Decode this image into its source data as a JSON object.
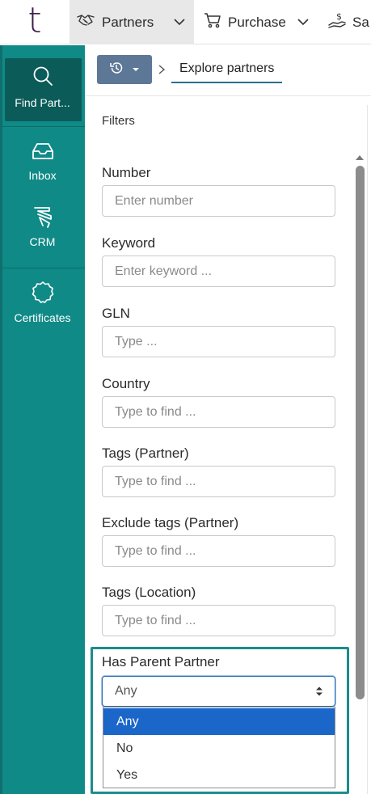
{
  "topbar": {
    "logo_text": "t",
    "nav": {
      "partners_label": "Partners",
      "purchase_label": "Purchase",
      "sales_label": "Sa"
    }
  },
  "rail": {
    "items": [
      {
        "label": "Find Part...",
        "icon": "search-icon",
        "active": true
      },
      {
        "label": "Inbox",
        "icon": "inbox-icon"
      },
      {
        "label": "CRM",
        "icon": "crm-icon"
      },
      {
        "label": "Certificates",
        "icon": "certificate-icon"
      }
    ]
  },
  "breadcrumb": {
    "history_icon": "history-icon",
    "current": "Explore partners"
  },
  "filters": {
    "title": "Filters",
    "fields": [
      {
        "label": "Number",
        "placeholder": "Enter number"
      },
      {
        "label": "Keyword",
        "placeholder": "Enter keyword ..."
      },
      {
        "label": "GLN",
        "placeholder": "Type ..."
      },
      {
        "label": "Country",
        "placeholder": "Type to find ..."
      },
      {
        "label": "Tags (Partner)",
        "placeholder": "Type to find ..."
      },
      {
        "label": "Exclude tags (Partner)",
        "placeholder": "Type to find ..."
      },
      {
        "label": "Tags (Location)",
        "placeholder": "Type to find ..."
      }
    ],
    "has_parent": {
      "label": "Has Parent Partner",
      "selected": "Any",
      "options": [
        "Any",
        "No",
        "Yes"
      ]
    }
  },
  "colors": {
    "rail": "#108a87",
    "rail_active": "#0b5b59",
    "highlight_border": "#1c8c8c",
    "history_button": "#5d7796",
    "selected_option": "#1a66c9"
  }
}
